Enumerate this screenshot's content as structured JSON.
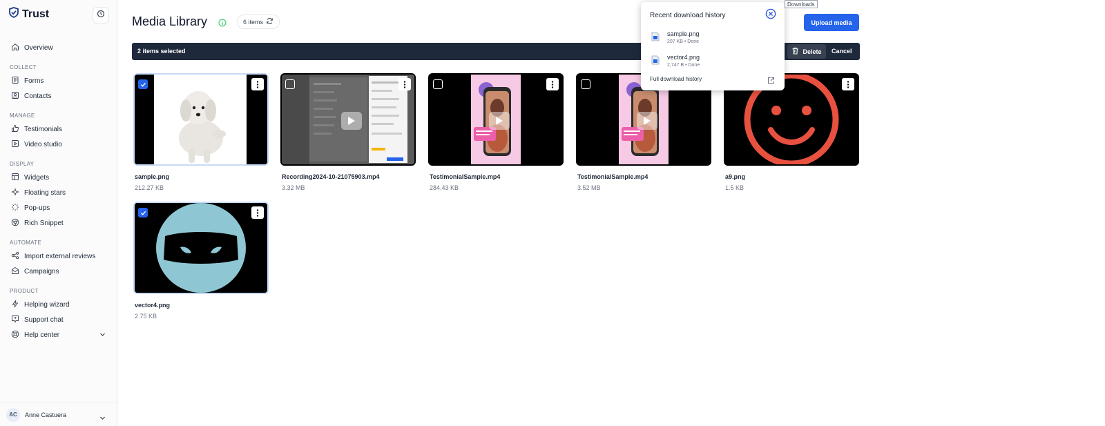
{
  "brand": {
    "name": "Trust"
  },
  "sidebar": {
    "top": [
      {
        "label": "Overview",
        "icon": "home-icon"
      }
    ],
    "sections": [
      {
        "title": "COLLECT",
        "items": [
          {
            "label": "Forms",
            "icon": "form-icon"
          },
          {
            "label": "Contacts",
            "icon": "contact-icon"
          }
        ]
      },
      {
        "title": "MANAGE",
        "items": [
          {
            "label": "Testimonials",
            "icon": "thumbs-up-icon"
          },
          {
            "label": "Video studio",
            "icon": "video-icon"
          }
        ]
      },
      {
        "title": "DISPLAY",
        "items": [
          {
            "label": "Widgets",
            "icon": "widget-icon"
          },
          {
            "label": "Floating stars",
            "icon": "sparkle-icon"
          },
          {
            "label": "Pop-ups",
            "icon": "loader-icon"
          },
          {
            "label": "Rich Snippet",
            "icon": "chrome-icon"
          }
        ]
      },
      {
        "title": "AUTOMATE",
        "items": [
          {
            "label": "Import external reviews",
            "icon": "share-icon"
          },
          {
            "label": "Campaigns",
            "icon": "mail-icon"
          }
        ]
      },
      {
        "title": "PRODUCT",
        "items": [
          {
            "label": "Helping wizard",
            "icon": "bolt-icon"
          },
          {
            "label": "Support chat",
            "icon": "chat-icon"
          },
          {
            "label": "Help center",
            "icon": "lifebuoy-icon"
          }
        ]
      }
    ],
    "user": {
      "initials": "AC",
      "name": "Anne Castuera"
    }
  },
  "header": {
    "title": "Media Library",
    "count": "6 items",
    "upload_label": "Upload media"
  },
  "selection": {
    "text": "2 items selected",
    "delete_label": "Delete",
    "cancel_label": "Cancel"
  },
  "media": [
    {
      "name": "sample.png",
      "size": "212.27 KB",
      "selected": true,
      "kind": "dog"
    },
    {
      "name": "Recording2024-10-21075903.mp4",
      "size": "3.32 MB",
      "selected": false,
      "kind": "recording"
    },
    {
      "name": "TestimonialSample.mp4",
      "size": "284.43 KB",
      "selected": false,
      "kind": "testimonial"
    },
    {
      "name": "TestimonialSample.mp4",
      "size": "3.52 MB",
      "selected": false,
      "kind": "testimonial"
    },
    {
      "name": "a9.png",
      "size": "1.5 KB",
      "selected": false,
      "kind": "smiley"
    },
    {
      "name": "vector4.png",
      "size": "2.75 KB",
      "selected": true,
      "kind": "ninja"
    }
  ],
  "downloads": {
    "tooltip": "Downloads",
    "title": "Recent download history",
    "items": [
      {
        "name": "sample.png",
        "meta": "207 KB • Done"
      },
      {
        "name": "vector4.png",
        "meta": "2,747 B • Done"
      }
    ],
    "full_label": "Full download history"
  },
  "colors": {
    "accent": "#2563eb",
    "bar": "#1e293b",
    "smiley": "#e8513f",
    "ninja": "#8ec7d3"
  }
}
